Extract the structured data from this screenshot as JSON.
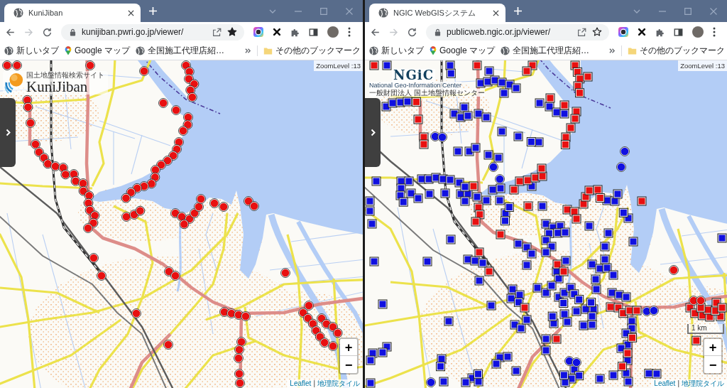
{
  "windows": [
    {
      "tab": {
        "title": "KuniJiban"
      },
      "forward": {
        "disabled": true
      },
      "address_bar": {
        "url": "kunijiban.pwri.go.jp/viewer/",
        "bookmarked": true
      },
      "bookmarks": [
        {
          "kind": "site",
          "label": "新しいタブ"
        },
        {
          "kind": "maps",
          "label": "Google マップ"
        },
        {
          "kind": "site",
          "label": "全国施工代理店紹…"
        }
      ],
      "other_bookmarks": {
        "label": "その他のブックマーク"
      },
      "map": {
        "logo": {
          "kind": "kunijiban",
          "tagline": "国土地盤情報検索サイト",
          "name": "KuniJiban"
        },
        "zoom_level": "ZoomLevel :13",
        "marker_layers": [
          {
            "kind": "circle",
            "color": "#e81010"
          }
        ],
        "zoom_control": {
          "zoom_in": "+",
          "zoom_out": "−"
        },
        "attribution": [
          {
            "kind": "link",
            "text": "Leaflet"
          },
          {
            "kind": "separator",
            "text": "|"
          },
          {
            "kind": "link",
            "text": "地理院タイル"
          }
        ]
      }
    },
    {
      "tab": {
        "title": "NGIC WebGISシステム"
      },
      "forward": {
        "disabled": true
      },
      "address_bar": {
        "url": "publicweb.ngic.or.jp/viewer/",
        "bookmarked": false
      },
      "bookmarks": [
        {
          "kind": "site",
          "label": "新しいタブ"
        },
        {
          "kind": "maps",
          "label": "Google マップ"
        },
        {
          "kind": "site",
          "label": "全国施工代理店紹…"
        }
      ],
      "other_bookmarks": {
        "label": "その他のブックマーク"
      },
      "map": {
        "logo": {
          "kind": "ngic",
          "name": "NGiC",
          "subtitle": "National Geo-Information Center",
          "tagline": "一般財団法人 国土地盤情報センター"
        },
        "zoom_level": "ZoomLevel :13",
        "marker_layers": [
          {
            "kind": "square",
            "color": "#1010e0"
          },
          {
            "kind": "square",
            "color": "#e81010"
          },
          {
            "kind": "circle",
            "color": "#1010e0"
          },
          {
            "kind": "circle",
            "color": "#e81010"
          }
        ],
        "scale": "1 km",
        "zoom_control": {
          "zoom_in": "+",
          "zoom_out": "−"
        },
        "attribution": [
          {
            "kind": "link",
            "text": "Leaflet"
          },
          {
            "kind": "separator",
            "text": "|"
          },
          {
            "kind": "link",
            "text": "地理院タイル"
          }
        ]
      }
    }
  ]
}
